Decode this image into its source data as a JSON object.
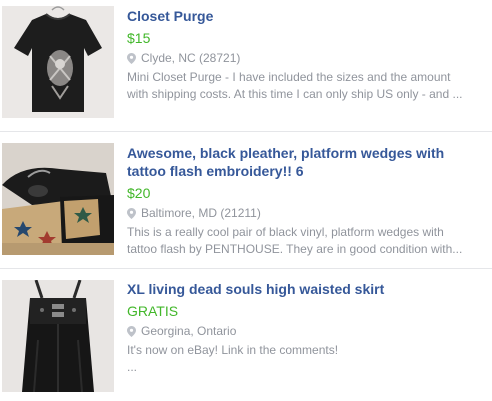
{
  "listings": [
    {
      "title": "Closet Purge",
      "price": "$15",
      "location": "Clyde, NC (28721)",
      "description": "Mini Closet Purge - I have included the sizes and the amount\nwith shipping costs. At this time I can only ship US only - and ...",
      "image": "black-graphic-tshirt"
    },
    {
      "title": "Awesome, black pleather, platform wedges with tattoo flash embroidery!! 6",
      "price": "$20",
      "location": "Baltimore, MD (21211)",
      "description": "This is a really cool pair of black vinyl, platform wedges with\ntattoo flash by PENTHOUSE. They are in good condition with...",
      "image": "black-platform-wedges"
    },
    {
      "title": "XL living dead souls high waisted skirt",
      "price": "GRATIS",
      "location": "Georgina, Ontario",
      "description": "It's now on eBay! Link in the comments!\n...",
      "image": "black-high-waisted-skirt"
    }
  ],
  "colors": {
    "title": "#365899",
    "price": "#42b72a",
    "meta": "#90949c",
    "divider": "#e5e6e9"
  },
  "icons": {
    "location": "location-pin-icon"
  }
}
